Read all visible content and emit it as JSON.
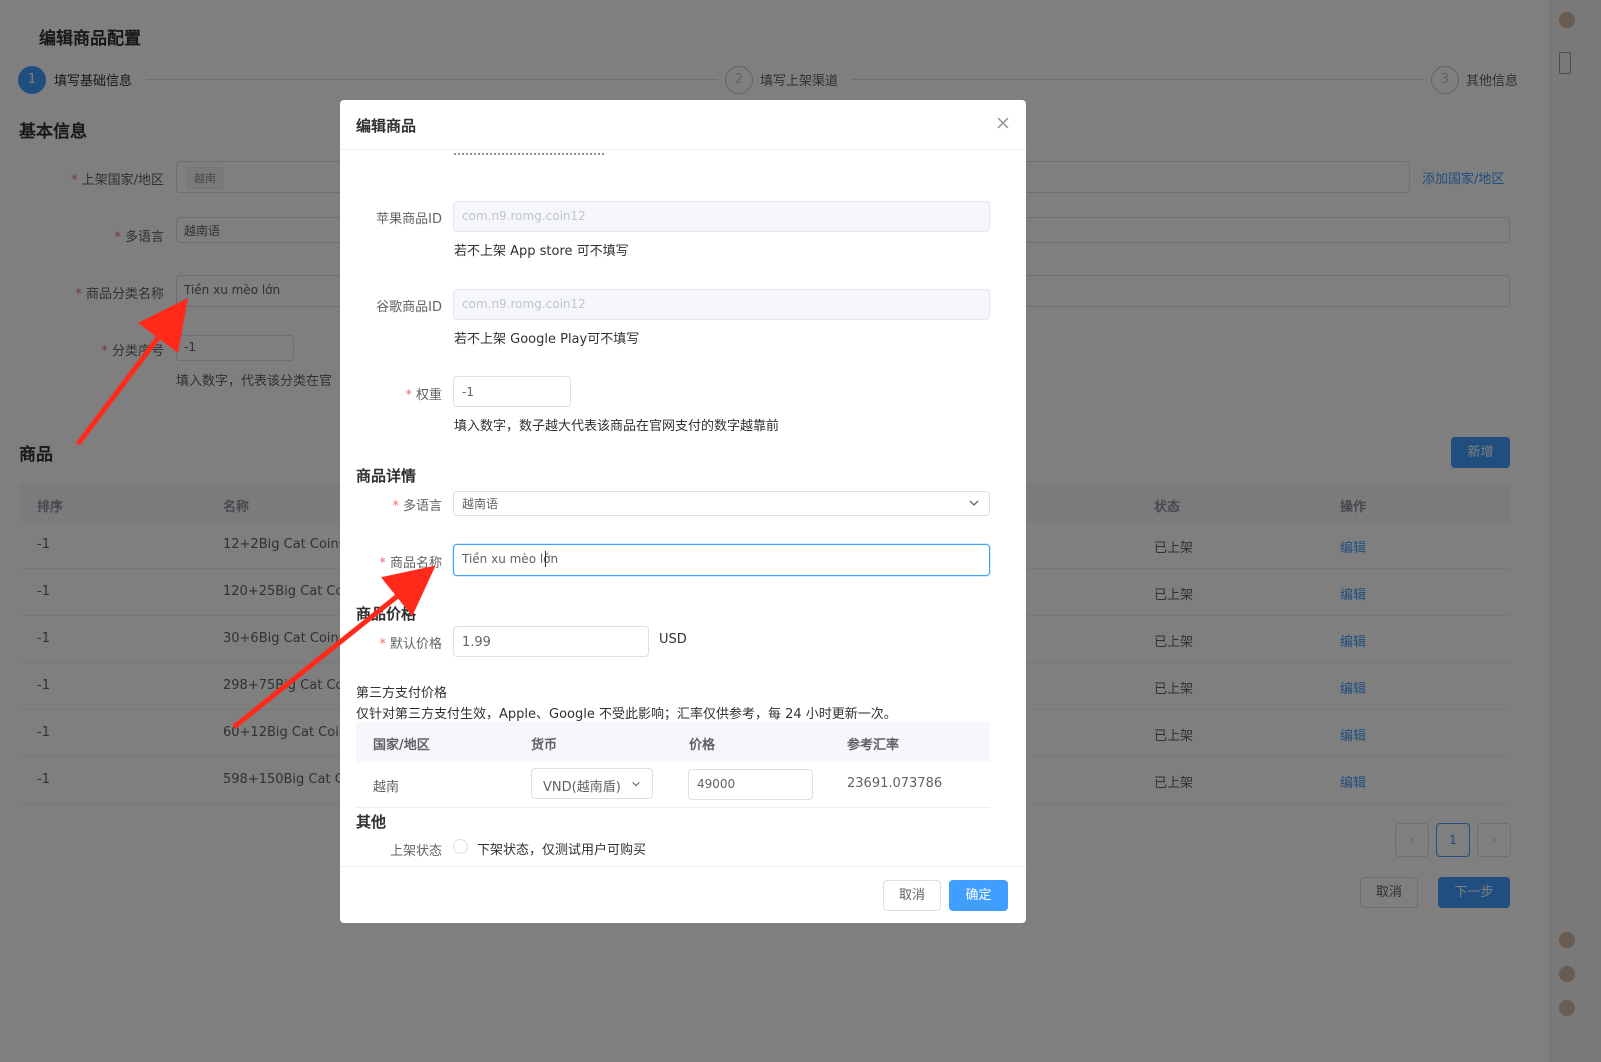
{
  "page": {
    "title": "编辑商品配置",
    "steps": [
      {
        "index": "1",
        "label": "填写基础信息"
      },
      {
        "index": "2",
        "label": "填写上架渠道"
      },
      {
        "index": "3",
        "label": "其他信息"
      }
    ],
    "basic_info_title": "基本信息",
    "fields": {
      "country_label": "上架国家/地区",
      "country_tag": "越南",
      "add_country_link": "添加国家/地区",
      "language_label": "多语言",
      "language_tag": "越南语",
      "category_label": "商品分类名称",
      "category_value": "Tiền xu mèo lớn",
      "sort_label": "分类序号",
      "sort_value": "-1",
      "sort_help": "填入数字，代表该分类在官"
    },
    "products_title": "商品",
    "add_button": "新增",
    "table": {
      "headers": {
        "order": "排序",
        "name": "名称",
        "status": "状态",
        "action": "操作"
      },
      "rows": [
        {
          "order": "-1",
          "name": "12+2Big Cat Coins",
          "status": "已上架",
          "action": "编辑"
        },
        {
          "order": "-1",
          "name": "120+25Big Cat Coi",
          "status": "已上架",
          "action": "编辑"
        },
        {
          "order": "-1",
          "name": "30+6Big Cat Coins",
          "status": "已上架",
          "action": "编辑"
        },
        {
          "order": "-1",
          "name": "298+75Big Cat Coi",
          "status": "已上架",
          "action": "编辑"
        },
        {
          "order": "-1",
          "name": "60+12Big Cat Coin",
          "status": "已上架",
          "action": "编辑"
        },
        {
          "order": "-1",
          "name": "598+150Big Cat Co",
          "status": "已上架",
          "action": "编辑"
        }
      ]
    },
    "pagination": {
      "prev": "‹",
      "current": "1",
      "next": "›"
    },
    "cancel_button": "取消",
    "next_button": "下一步"
  },
  "modal": {
    "title": "编辑商品",
    "apple_id_label": "苹果商品ID",
    "apple_id_placeholder": "com.n9.romg.coin12",
    "apple_id_help": "若不上架 App store 可不填写",
    "google_id_label": "谷歌商品ID",
    "google_id_placeholder": "com.n9.romg.coin12",
    "google_id_help": "若不上架 Google Play可不填写",
    "weight_label": "权重",
    "weight_value": "-1",
    "weight_help": "填入数字，数子越大代表该商品在官网支付的数字越靠前",
    "detail_section": "商品详情",
    "language_label": "多语言",
    "language_value": "越南语",
    "name_label": "商品名称",
    "name_value": "Tiền xu mèo lớn",
    "price_section": "商品价格",
    "default_price_label": "默认价格",
    "default_price_value": "1.99",
    "currency_unit": "USD",
    "third_party_title": "第三方支付价格",
    "third_party_note": "仅针对第三方支付生效，Apple、Google 不受此影响；汇率仅供参考，每 24 小时更新一次。",
    "pay_table": {
      "headers": {
        "country": "国家/地区",
        "currency": "货币",
        "price": "价格",
        "rate": "参考汇率"
      },
      "row": {
        "country": "越南",
        "currency": "VND(越南盾)",
        "price": "49000",
        "rate": "23691.073786"
      }
    },
    "other_section": "其他",
    "status_label": "上架状态",
    "status_option": "下架状态，仅测试用户可购买",
    "cancel_button": "取消",
    "confirm_button": "确定"
  },
  "colors": {
    "primary": "#409eff",
    "required": "#f56c6c",
    "arrow": "#ff2a1a"
  }
}
